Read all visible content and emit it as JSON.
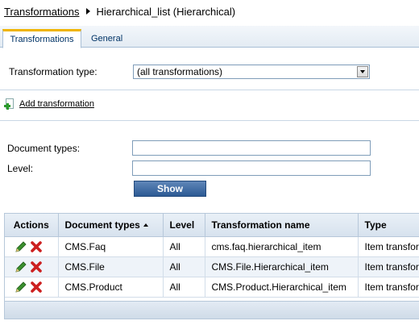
{
  "breadcrumb": {
    "parent": "Transformations",
    "current": "Hierarchical_list (Hierarchical)"
  },
  "tabs": [
    {
      "label": "Transformations",
      "active": true
    },
    {
      "label": "General",
      "active": false
    }
  ],
  "transformation_type": {
    "label": "Transformation type:",
    "selected": "(all transformations)"
  },
  "add_transformation": {
    "label": "Add transformation",
    "icon": "add-document-icon"
  },
  "filter": {
    "document_types_label": "Document types:",
    "document_types_value": "",
    "level_label": "Level:",
    "level_value": "",
    "show_label": "Show"
  },
  "grid": {
    "columns": [
      "Actions",
      "Document types",
      "Level",
      "Transformation name",
      "Type"
    ],
    "sort_column": "Document types",
    "sort_direction": "ascending",
    "rows": [
      {
        "doc_type": "CMS.Faq",
        "level": "All",
        "name": "cms.faq.hierarchical_item",
        "type": "Item transformation"
      },
      {
        "doc_type": "CMS.File",
        "level": "All",
        "name": "CMS.File.Hierarchical_item",
        "type": "Item transformation"
      },
      {
        "doc_type": "CMS.Product",
        "level": "All",
        "name": "CMS.Product.Hierarchical_item",
        "type": "Item transformation"
      }
    ]
  },
  "colors": {
    "tab_accent": "#f0b400",
    "button": "#2c5a94",
    "row_alt": "#eef3f9",
    "edit_icon": "#3a8f2e",
    "delete_icon": "#cc1f1f"
  }
}
